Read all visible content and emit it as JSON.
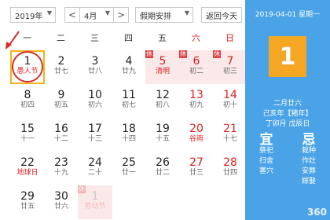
{
  "toolbar": {
    "year": "2019年",
    "prev": "<",
    "month": "4月",
    "next": ">",
    "holiday": "假期安排",
    "today_btn": "返回今天"
  },
  "weekdays": [
    "一",
    "二",
    "三",
    "四",
    "五",
    "六",
    "日"
  ],
  "days": [
    {
      "num": "1",
      "lunar": "愚人节"
    },
    {
      "num": "2",
      "lunar": "廿七"
    },
    {
      "num": "3",
      "lunar": "廿八"
    },
    {
      "num": "4",
      "lunar": "廿九"
    },
    {
      "num": "5",
      "lunar": "清明",
      "tag": "休"
    },
    {
      "num": "6",
      "lunar": "初二",
      "tag": "休"
    },
    {
      "num": "7",
      "lunar": "初三",
      "tag": "休"
    },
    {
      "num": "8",
      "lunar": "初四"
    },
    {
      "num": "9",
      "lunar": "初五"
    },
    {
      "num": "10",
      "lunar": "初六"
    },
    {
      "num": "11",
      "lunar": "初七"
    },
    {
      "num": "12",
      "lunar": "初八"
    },
    {
      "num": "13",
      "lunar": "初九"
    },
    {
      "num": "14",
      "lunar": "初十"
    },
    {
      "num": "15",
      "lunar": "十一"
    },
    {
      "num": "16",
      "lunar": "十二"
    },
    {
      "num": "17",
      "lunar": "十三"
    },
    {
      "num": "18",
      "lunar": "十四"
    },
    {
      "num": "19",
      "lunar": "十五"
    },
    {
      "num": "20",
      "lunar": "谷雨"
    },
    {
      "num": "21",
      "lunar": "十七"
    },
    {
      "num": "22",
      "lunar": "地球日"
    },
    {
      "num": "23",
      "lunar": "十九"
    },
    {
      "num": "24",
      "lunar": "二十"
    },
    {
      "num": "25",
      "lunar": "廿一"
    },
    {
      "num": "26",
      "lunar": "廿二"
    },
    {
      "num": "27",
      "lunar": "廿三"
    },
    {
      "num": "28",
      "lunar": "廿四"
    },
    {
      "num": "29",
      "lunar": "廿五"
    },
    {
      "num": "30",
      "lunar": "廿六"
    },
    {
      "num": "1",
      "lunar": "劳动节",
      "tag": "休"
    }
  ],
  "side": {
    "date": "2019-04-01 星期一",
    "big": "1",
    "lunar": "二月廿六",
    "year_gz": "己亥年【猪年】",
    "month_day_gz": "丁卯月 戊辰日",
    "yi_title": "宜",
    "ji_title": "忌",
    "yi": [
      "祭祀",
      "扫舍",
      "塞穴"
    ],
    "ji": [
      "栽种",
      "作灶",
      "安葬",
      "嫁娶"
    ],
    "watermark": "360"
  },
  "colors": {
    "side_bg": "#4aa3e6",
    "big_box": "#f5a623",
    "holiday_red": "#e02020",
    "today_border": "#f5b21a"
  }
}
